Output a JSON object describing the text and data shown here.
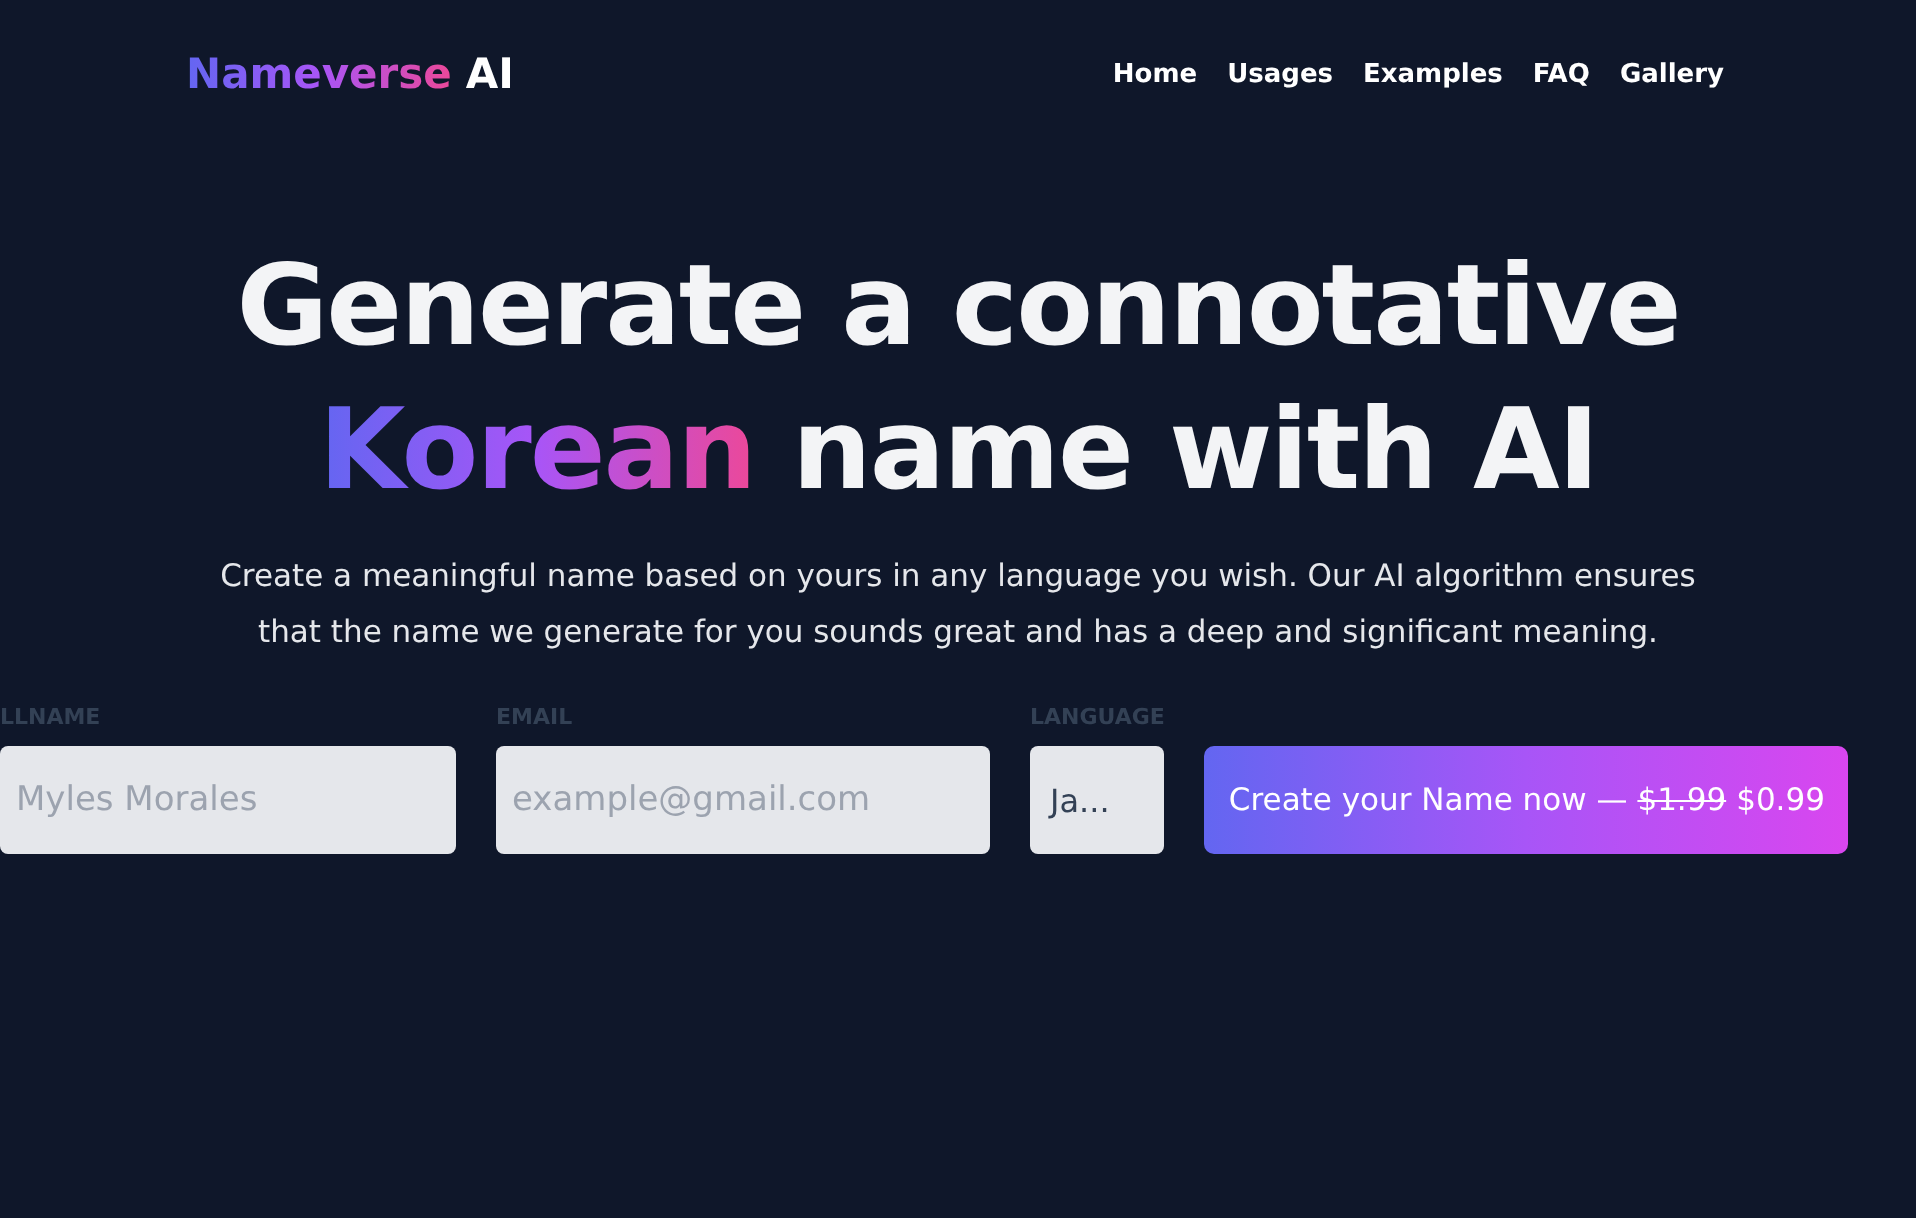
{
  "brand": {
    "name": "Nameverse",
    "suffix": "AI"
  },
  "nav": [
    "Home",
    "Usages",
    "Examples",
    "FAQ",
    "Gallery"
  ],
  "hero": {
    "title_start": "Generate a connotative",
    "highlight": "Korean",
    "title_end": "name with AI",
    "description": "Create a meaningful name based on yours in any language you wish. Our AI algorithm ensures that the name we generate for you sounds great and has a deep and significant meaning."
  },
  "form": {
    "fields": [
      {
        "label": "LLNAME",
        "placeholder": "Myles Morales",
        "kind": "text"
      },
      {
        "label": "EMAIL",
        "placeholder": "example@gmail.com",
        "kind": "text"
      },
      {
        "label": "LANGUAGE",
        "value": "Ja...",
        "kind": "select"
      }
    ],
    "button": {
      "label": "Create your Name now —",
      "old_price": "$1.99",
      "new_price": "$0.99"
    }
  }
}
